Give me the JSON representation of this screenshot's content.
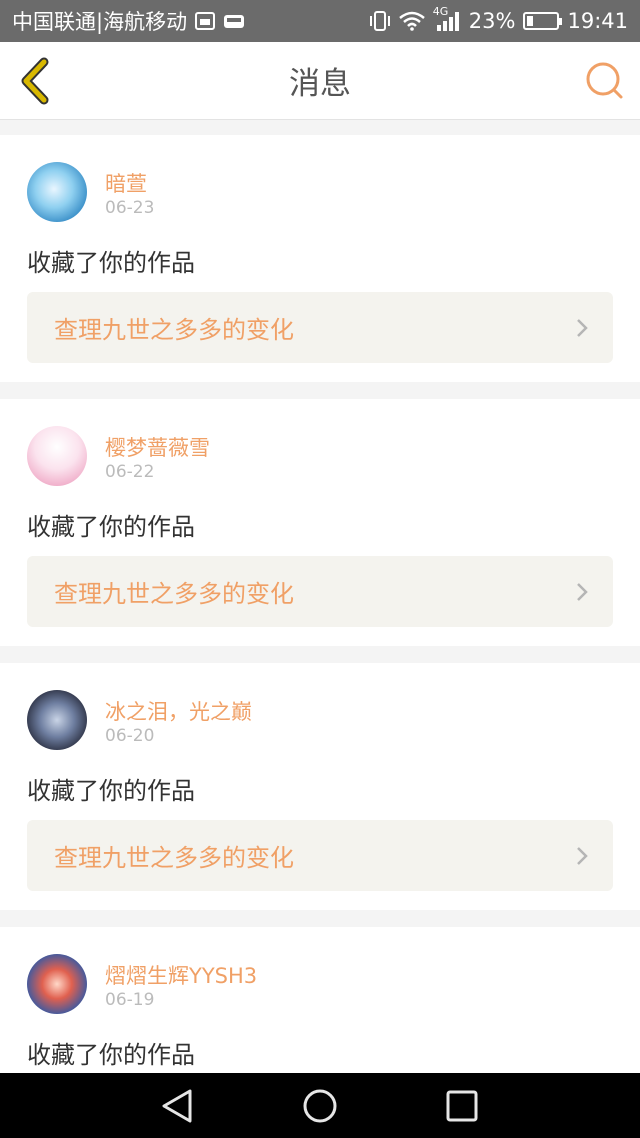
{
  "status_bar": {
    "carrier": "中国联通|海航移动",
    "network": "4G",
    "battery_percent": "23%",
    "battery_level": 0.23,
    "time": "19:41",
    "icons": [
      "image-notification-icon",
      "car-notification-icon",
      "vibrate-icon",
      "wifi-icon",
      "signal-icon",
      "battery-icon"
    ]
  },
  "header": {
    "title": "消息",
    "back_icon": "chevron-left-icon",
    "search_icon": "search-icon"
  },
  "colors": {
    "accent": "#f0a066",
    "back_icon": "#d8b800",
    "text": "#333333",
    "muted": "#bbbbbb",
    "work_bg": "#f4f3ee"
  },
  "messages": [
    {
      "user": "暗萱",
      "date": "06-23",
      "text": "收藏了你的作品",
      "work": "查理九世之多多的变化"
    },
    {
      "user": "樱梦蔷薇雪",
      "date": "06-22",
      "text": "收藏了你的作品",
      "work": "查理九世之多多的变化"
    },
    {
      "user": "冰之泪，光之巅",
      "date": "06-20",
      "text": "收藏了你的作品",
      "work": "查理九世之多多的变化"
    },
    {
      "user": "熠熠生辉YYSH3",
      "date": "06-19",
      "text": "收藏了你的作品",
      "work": ""
    }
  ],
  "nav": {
    "icons": [
      "back-triangle-icon",
      "home-circle-icon",
      "recents-square-icon"
    ]
  }
}
